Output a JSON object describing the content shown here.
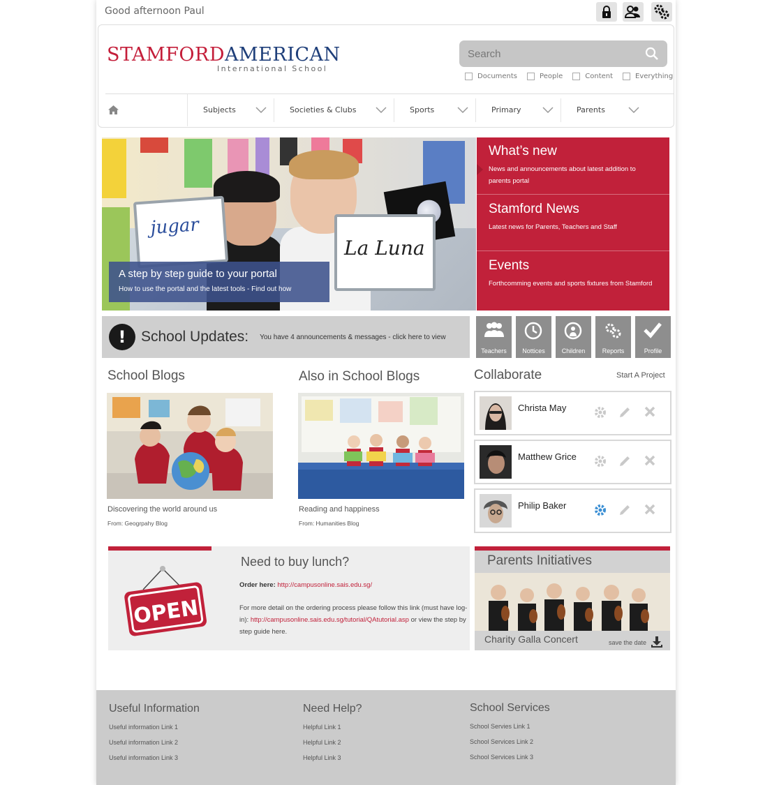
{
  "greeting": "Good afternoon Paul",
  "top_icons": [
    "lock-icon",
    "users-icon",
    "settings-icon"
  ],
  "logo": {
    "part1": "STAMFORD",
    "part2": "AMERICAN",
    "subtitle": "International School"
  },
  "search": {
    "placeholder": "Search",
    "filters": [
      "Documents",
      "People",
      "Content",
      "Everything"
    ]
  },
  "nav": {
    "items": [
      "Subjects",
      "Societies & Clubs",
      "Sports",
      "Primary",
      "Parents"
    ]
  },
  "hero": {
    "board_left": "jugar",
    "board_right": "La Luna",
    "caption_title": "A step by step guide to your portal",
    "caption_sub": "How to use the portal and the latest tools - Find out how"
  },
  "red_panel": [
    {
      "title": "What’s new",
      "desc": "News and announcements about latest addition to parents portal"
    },
    {
      "title": "Stamford News",
      "desc": "Latest news for Parents, Teachers and Staff"
    },
    {
      "title": "Events",
      "desc": "Forthcomming events and sports fixtures from Stamford"
    }
  ],
  "updates": {
    "title": "School Updates:",
    "message": "You have 4 announcements & messages - click here to view"
  },
  "tiles": [
    "Teachers",
    "Nottices",
    "Children",
    "Reports",
    "Profile"
  ],
  "blogs": {
    "heading1": "School Blogs",
    "heading2": "Also in School Blogs",
    "post1": {
      "caption": "Discovering the world around us",
      "from": "From: Geogrpahy Blog"
    },
    "post2": {
      "caption": "Reading and happiness",
      "from": "From: Humanities Blog"
    }
  },
  "collaborate": {
    "heading": "Collaborate",
    "start": "Start A Project",
    "people": [
      "Christa May",
      "Matthew Grice",
      "Philip Baker"
    ]
  },
  "lunch": {
    "heading": "Need to buy lunch?",
    "order_label": "Order here:",
    "order_link": "http://campusonline.sais.edu.sg/",
    "detail_pre": "For more detail on the ordering process please follow this link (must have log-in):",
    "detail_link": "http://campusonline.sais.edu.sg/tutorial/QAtutorial.asp",
    "detail_post": "or view the step by step guide here.",
    "sign_text": "OPEN"
  },
  "parents": {
    "heading": "Parents Initiatives",
    "caption": "Charity Galla Concert",
    "save": "save the date"
  },
  "footer": {
    "col1": {
      "heading": "Useful Information",
      "links": [
        "Useful information Link 1",
        "Useful information Link 2",
        "Useful information Link 3"
      ]
    },
    "col2": {
      "heading": "Need Help?",
      "links": [
        "Helpful Link 1",
        "Helpful Link 2",
        "Helpful Link 3"
      ]
    },
    "col3": {
      "heading": "School Services",
      "links": [
        "School Servies Link 1",
        "School Services Link 2",
        "School Services Link 3"
      ]
    }
  },
  "colors": {
    "brand_red": "#c1213a",
    "brand_blue": "#1f3f7a",
    "tile_gray": "#8e8e8e",
    "footer_gray": "#cbcbcb"
  }
}
